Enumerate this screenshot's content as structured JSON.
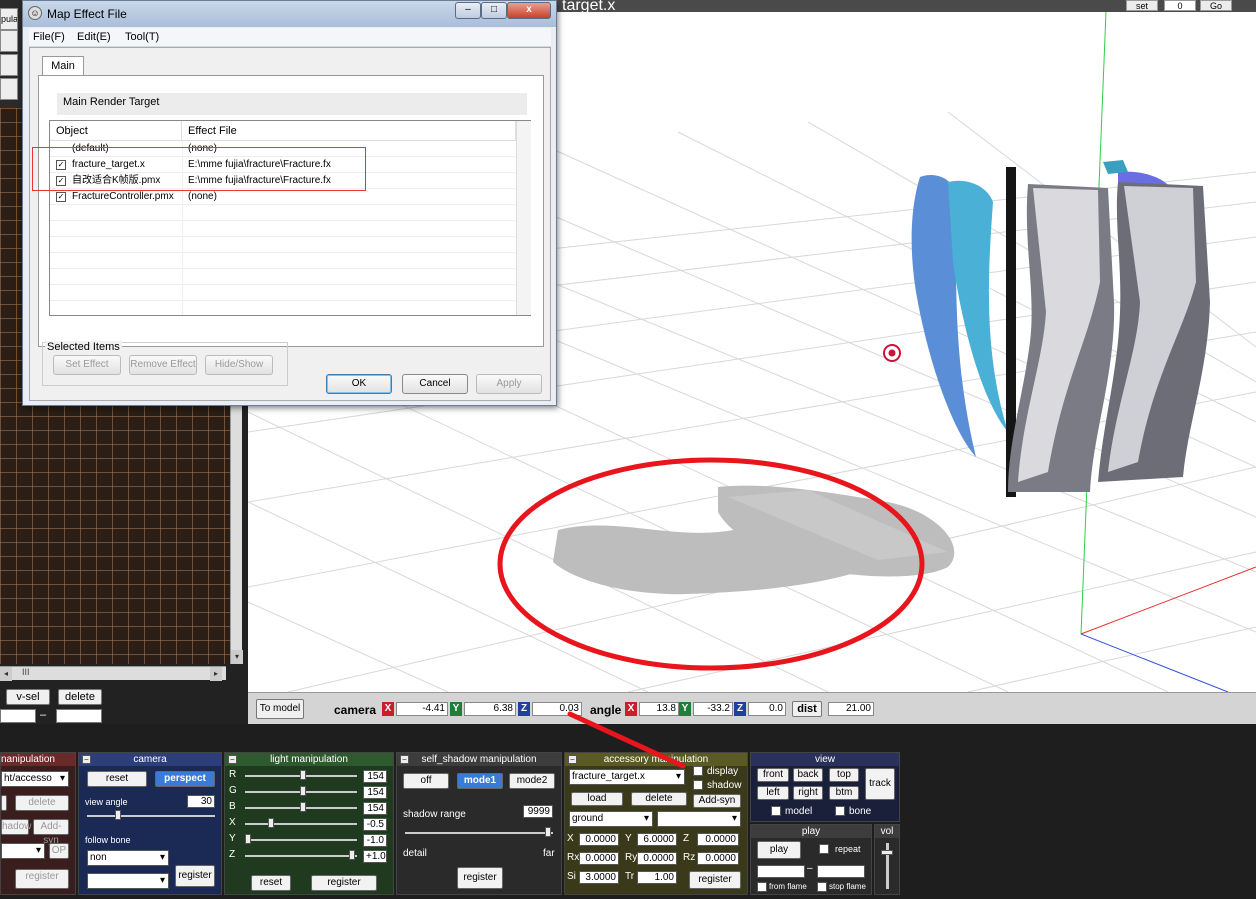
{
  "dialog": {
    "title": "Map Effect File",
    "icon": "☺",
    "win_buttons": {
      "minimize": "–",
      "maximize": "□",
      "close": "x"
    },
    "menu": [
      "File(F)",
      "Edit(E)",
      "Tool(T)"
    ],
    "tab": "Main",
    "render_target": "Main Render Target",
    "columns": [
      "Object",
      "Effect File"
    ],
    "rows": [
      {
        "object": "(default)",
        "effect": "(none)",
        "checked": false
      },
      {
        "object": "fracture_target.x",
        "effect": "E:\\mme fujia\\fracture\\Fracture.fx",
        "checked": true
      },
      {
        "object": "自改适合K帧版.pmx",
        "effect": "E:\\mme fujia\\fracture\\Fracture.fx",
        "checked": true
      },
      {
        "object": "FractureController.pmx",
        "effect": "(none)",
        "checked": true
      }
    ],
    "selected_items_label": "Selected Items",
    "set_effect": "Set Effect",
    "remove_effect": "Remove Effect",
    "hide_show": "Hide/Show",
    "ok": "OK",
    "cancel": "Cancel",
    "apply": "Apply"
  },
  "left_panel": {
    "fragment_text": "pula",
    "hscroll_mark": "III",
    "scroll_left": "◂",
    "scroll_right": "▸",
    "scroll_down": "▾",
    "v_sel": "v-sel",
    "delete": "delete",
    "range_dash": "–",
    "range_sel": "ange-sel",
    "expand": "expand"
  },
  "viewport": {
    "title": "target.x",
    "set": "set",
    "frame": "0",
    "go": "Go"
  },
  "camera_bar": {
    "to_model": "To model",
    "camera_label": "camera",
    "x": "-4.41",
    "y": "6.38",
    "z": "0.03",
    "angle_label": "angle",
    "ax": "13.8",
    "ay": "-33.2",
    "az": "0.0",
    "dist_label": "dist",
    "dist": "21.00",
    "axis_x": "X",
    "axis_y": "Y",
    "axis_z": "Z"
  },
  "model_panel": {
    "title": "nanipulation",
    "select": "ht/accesso",
    "delete": "delete",
    "shadow": "hadow",
    "add_syn": "Add-syn",
    "op": "OP",
    "register": "register"
  },
  "camera_panel": {
    "title": "camera",
    "reset": "reset",
    "perspect": "perspect",
    "view_angle_label": "view angle",
    "view_angle": "30",
    "follow_bone_label": "follow bone",
    "follow_bone": "non",
    "register": "register",
    "view_angle_level": 0.35
  },
  "light_panel": {
    "title": "light manipulation",
    "labels": [
      "R",
      "G",
      "B",
      "X",
      "Y",
      "Z"
    ],
    "values": [
      "154",
      "154",
      "154",
      "-0.5",
      "-1.0",
      "+1.0"
    ],
    "reset": "reset",
    "register": "register"
  },
  "shadow_panel": {
    "title": "self_shadow manipulation",
    "off": "off",
    "mode1": "mode1",
    "mode2": "mode2",
    "range_label": "shadow range",
    "range_value": "9999",
    "detail": "detail",
    "far": "far",
    "register": "register"
  },
  "accessory_panel": {
    "title": "accessory manipulation",
    "accessory": "fracture_target.x",
    "display": "display",
    "shadow": "shadow",
    "load": "load",
    "delete": "delete",
    "add_syn": "Add-syn",
    "parent": "ground",
    "x_label": "X",
    "x": "0.0000",
    "y_label": "Y",
    "y": "6.0000",
    "z_label": "Z",
    "z": "0.0000",
    "rx_label": "Rx",
    "rx": "0.0000",
    "ry_label": "Ry",
    "ry": "0.0000",
    "rz_label": "Rz",
    "rz": "0.0000",
    "si_label": "Si",
    "si": "3.0000",
    "tr_label": "Tr",
    "tr": "1.00",
    "register": "register"
  },
  "view_panel": {
    "title": "view",
    "front": "front",
    "back": "back",
    "top": "top",
    "left": "left",
    "right": "right",
    "btm": "btm",
    "track": "track",
    "model": "model",
    "bone": "bone"
  },
  "play_panel": {
    "title": "play",
    "play": "play",
    "repeat": "repeat",
    "range_dash": "–",
    "from_flame": "from flame",
    "stop_flame": "stop flame"
  },
  "vol_panel": {
    "title": "vol",
    "level": 0.85
  },
  "colors": {
    "annotation_red": "#e8151c",
    "active_button": "#3b7bd8",
    "light_panel_bg": "#1f3a1f",
    "camera_panel_bg": "#1a2a55",
    "shadow_panel_bg": "#2a2a2a",
    "accessory_panel_bg": "#3a3a1a",
    "view_panel_bg": "#1a1f3a"
  }
}
